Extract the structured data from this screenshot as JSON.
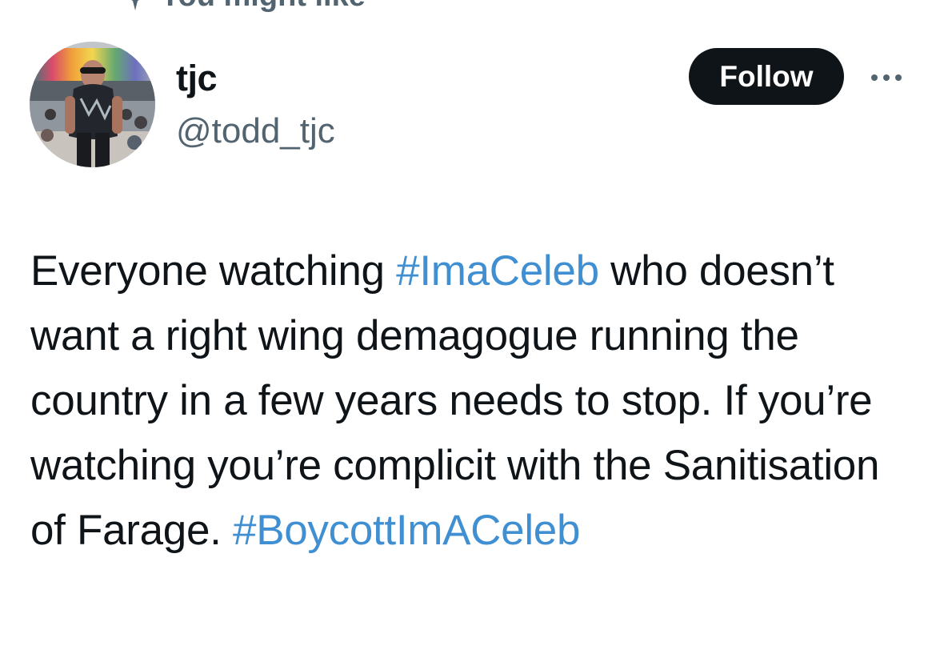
{
  "context": {
    "label": "You might like",
    "icon": "sparkle-icon"
  },
  "author": {
    "display_name": "tjc",
    "handle": "@todd_tjc",
    "avatar": "avatar-photo"
  },
  "actions": {
    "follow_label": "Follow",
    "more_icon": "more-horizontal-icon"
  },
  "tweet": {
    "segment_1": "Everyone watching ",
    "hashtag_1": "#ImaCeleb",
    "segment_2": " who doesn’t want a right wing demagogue running the country in a few years needs to stop. If you’re watching you’re complicit with the Sanitisation of Farage. ",
    "hashtag_2": "#BoycottImACeleb"
  },
  "colors": {
    "text": "#0f1419",
    "secondary_text": "#536471",
    "link": "#3f8fd2",
    "button_bg": "#0f1419",
    "button_text": "#ffffff"
  }
}
